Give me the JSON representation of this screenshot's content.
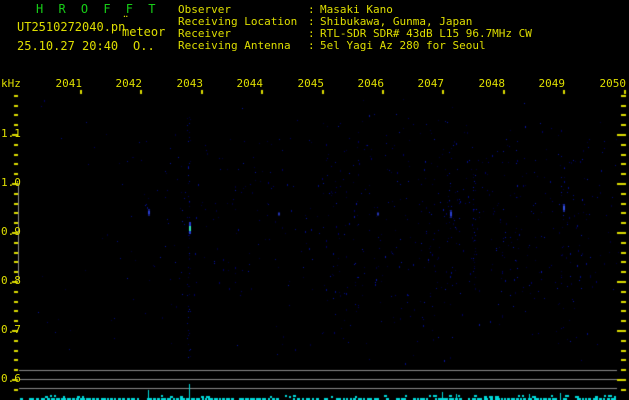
{
  "header": {
    "title": "H R O F F T",
    "filename": "UT2510272040.pn",
    "filename_tail": "¨",
    "station": "meteor",
    "datetime": "25.10.27 20:40",
    "counter": "O..",
    "info": [
      {
        "label": "Observer",
        "sep": ":",
        "value": "Masaki Kano"
      },
      {
        "label": "Receiving Location",
        "sep": ":",
        "value": "Shibukawa, Gunma, Japan"
      },
      {
        "label": "Receiver",
        "sep": ":",
        "value": "RTL-SDR SDR# 43dB L15 96.7MHz CW"
      },
      {
        "label": "Receiving Antenna",
        "sep": ":",
        "value": "5el Yagi Az 280 for Seoul"
      }
    ]
  },
  "colors": {
    "background": "#000000",
    "text_yellow": "#dede00",
    "title_green": "#17cd17",
    "grid_gray": "#8a8a8a",
    "trace_cyan": "#00d9d9",
    "noise_blue": "#0a14a6",
    "echo_peak": "#2fe0b0"
  },
  "chart_data": {
    "type": "heatmap",
    "title": "HROFFT meteor radio echo spectrogram, 10-minute frame 20:40-20:50 UT",
    "x_axis": {
      "unit": "UT time (HHMM)",
      "labels": [
        "2041",
        "2042",
        "2043",
        "2044",
        "2045",
        "2046",
        "2047",
        "2048",
        "2049",
        "2050"
      ],
      "range_minutes": [
        0,
        10
      ],
      "tick_step_minutes": 1
    },
    "y_axis": {
      "unit": "kHz",
      "labels": [
        "1.1",
        "1.0",
        "0.9",
        "0.8",
        "0.7",
        "0.6"
      ],
      "tick_values": [
        1.1,
        1.0,
        0.9,
        0.8,
        0.7,
        0.6
      ],
      "minor_step": 0.02,
      "range": [
        0.58,
        1.19
      ]
    },
    "count_band_khz": [
      0.8,
      1.0
    ],
    "level_rules_y": [
      370,
      379,
      388
    ],
    "noise_palette": [
      "#00003c",
      "#000066",
      "#000d86",
      "#0a14a6"
    ],
    "noise_regions": [
      {
        "t0": 0.3,
        "t1": 9.95,
        "f0": 0.63,
        "f1": 1.17,
        "dots": 160
      },
      {
        "t0": 1.6,
        "t1": 9.95,
        "f0": 0.77,
        "f1": 1.09,
        "dots": 330
      },
      {
        "t0": 5.0,
        "t1": 9.4,
        "f0": 0.67,
        "f1": 1.13,
        "dots": 300
      }
    ],
    "echo_trails": [
      {
        "t_min": 2.8,
        "f_low": 0.64,
        "f_high": 1.16,
        "dots": 55
      },
      {
        "t_min": 7.53,
        "f_low": 0.8,
        "f_high": 1.02,
        "dots": 32
      },
      {
        "t_min": 8.99,
        "f_low": 0.7,
        "f_high": 1.02,
        "dots": 20
      },
      {
        "t_min": 7.12,
        "f_low": 0.86,
        "f_high": 1.0,
        "dots": 12
      }
    ],
    "echoes": [
      {
        "t_min": 2.8,
        "f_low": 0.896,
        "f_high": 0.92,
        "peak_color": "#2fe0b0",
        "edge_color": "#2238cc",
        "strong": true
      },
      {
        "t_min": 2.12,
        "f_low": 0.932,
        "f_high": 0.946,
        "peak_color": "#2a3fd0",
        "edge_color": "#141e80",
        "strong": false
      },
      {
        "t_min": 7.12,
        "f_low": 0.928,
        "f_high": 0.944,
        "peak_color": "#2a3fd0",
        "edge_color": "#141e80",
        "strong": false
      },
      {
        "t_min": 8.99,
        "f_low": 0.94,
        "f_high": 0.958,
        "peak_color": "#3550e0",
        "edge_color": "#1a2a99",
        "strong": false
      },
      {
        "t_min": 4.27,
        "f_low": 0.933,
        "f_high": 0.94,
        "peak_color": "#2233b0",
        "edge_color": "#101860",
        "strong": false
      },
      {
        "t_min": 5.91,
        "f_low": 0.933,
        "f_high": 0.94,
        "peak_color": "#2233b0",
        "edge_color": "#101860",
        "strong": false
      }
    ],
    "level_trace": {
      "dense_from_t_min": 6.6,
      "spikes": [
        {
          "t_min": 2.12,
          "level": 10
        },
        {
          "t_min": 2.81,
          "level": 16
        },
        {
          "t_min": 7.0,
          "level": 8
        },
        {
          "t_min": 7.23,
          "level": 6
        },
        {
          "t_min": 8.44,
          "level": 6
        },
        {
          "t_min": 8.94,
          "level": 7
        }
      ]
    }
  }
}
